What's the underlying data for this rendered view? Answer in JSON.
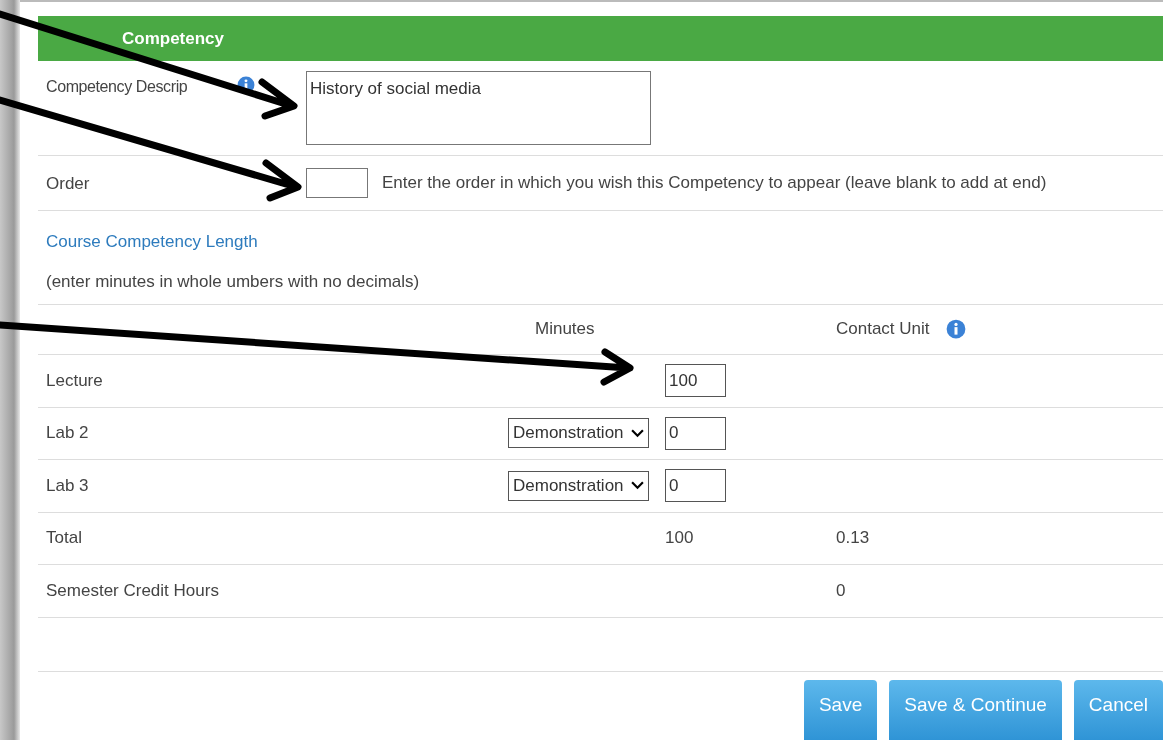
{
  "header": {
    "title": "Competency"
  },
  "description": {
    "label": "Competency Descrip",
    "value": "History of social media"
  },
  "order": {
    "label": "Order",
    "hint": "Enter the order in which you wish this Competency to appear (leave blank to add at end)"
  },
  "section_title": "Course Competency Length",
  "note": "(enter minutes in whole umbers with no decimals)",
  "columns": [
    "Minutes",
    "Contact Unit"
  ],
  "rows": [
    {
      "label": "Lecture",
      "kind": "input",
      "minutes": "100"
    },
    {
      "label": "Lab 2",
      "kind": "select",
      "type": "Demonstration",
      "minutes": "0"
    },
    {
      "label": "Lab 3",
      "kind": "select",
      "type": "Demonstration",
      "minutes": "0"
    },
    {
      "label": "Total",
      "kind": "text",
      "minutes": "100",
      "contact_unit": "0.13"
    },
    {
      "label": "Semester Credit Hours",
      "kind": "text",
      "contact_unit": "0"
    }
  ],
  "buttons": [
    "Save",
    "Save & Continue",
    "Cancel"
  ]
}
